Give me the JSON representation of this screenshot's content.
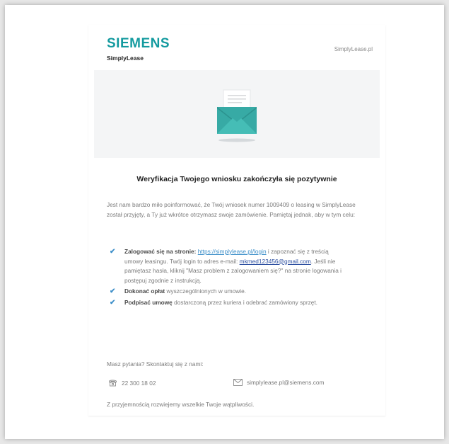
{
  "header": {
    "brand": "SIEMENS",
    "product": "SimplyLease",
    "site_link": "SimplyLease.pl"
  },
  "hero": {
    "icon": "envelope-icon",
    "accent_color": "#3fb6b0"
  },
  "content": {
    "title": "Weryfikacja Twojego wniosku zakończyła się pozytywnie",
    "intro": "Jest nam bardzo miło poinformować, że Twój wniosek numer 1009409 o leasing w SimplyLease został przyjęty, a Ty już wkrótce otrzymasz swoje zamówienie. Pamiętaj jednak, aby w tym celu:",
    "step1": {
      "bold": "Zalogować się na stronie:",
      "link": "https://simplylease.pl/login",
      "after_link": " i zapoznać się z treścią umowy leasingu. Twój login to adres e-mail:",
      "email": "mkmed123456@gmail.com",
      "rest": ". Jeśli nie pamiętasz hasła, kliknij \"Masz problem z zalogowaniem się?\" na stronie logowania i postępuj zgodnie z instrukcją."
    },
    "step2": {
      "bold": "Dokonać opłat",
      "rest": " wyszczególnionych w umowie."
    },
    "step3": {
      "bold": "Podpisać umowę",
      "rest": " dostarczoną przez kuriera i odebrać zamówiony sprzęt."
    },
    "questions": "Masz pytania? Skontaktuj się z nami:",
    "phone": "22 300 18 02",
    "contact_email": "simplylease.pl@siemens.com",
    "closing": "Z przyjemnością rozwiejemy wszelkie Twoje wątpliwości."
  },
  "colors": {
    "brand": "#139a9f",
    "check": "#3d8fc9",
    "link": "#3d8fc9"
  }
}
